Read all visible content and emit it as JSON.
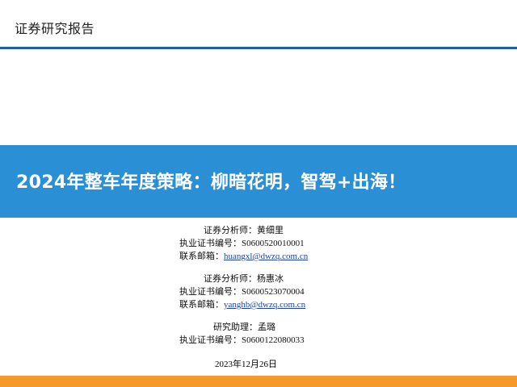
{
  "header": {
    "title": "证券研究报告"
  },
  "banner": {
    "title": "2024年整车年度策略：柳暗花明，智驾+出海！"
  },
  "analysts": [
    {
      "role_label": "证券分析师：",
      "name": "黄细里",
      "cert_label": "执业证书编号：",
      "cert": "S0600520010001",
      "email_label": "联系邮箱：",
      "email": "huangxl@dwzq.com.cn"
    },
    {
      "role_label": "证券分析师：",
      "name": "杨惠冰",
      "cert_label": "执业证书编号：",
      "cert": "S0600523070004",
      "email_label": "联系邮箱：",
      "email": "yanghb@dwzq.com.cn"
    }
  ],
  "assistant": {
    "role_label": "研究助理：",
    "name": "孟璐",
    "cert_label": "执业证书编号：",
    "cert": "S0600122080033"
  },
  "date": "2023年12月26日",
  "colors": {
    "header_rule": "#1f5fa8",
    "banner": "#2a8fd4",
    "footer": "#f39a2b"
  }
}
